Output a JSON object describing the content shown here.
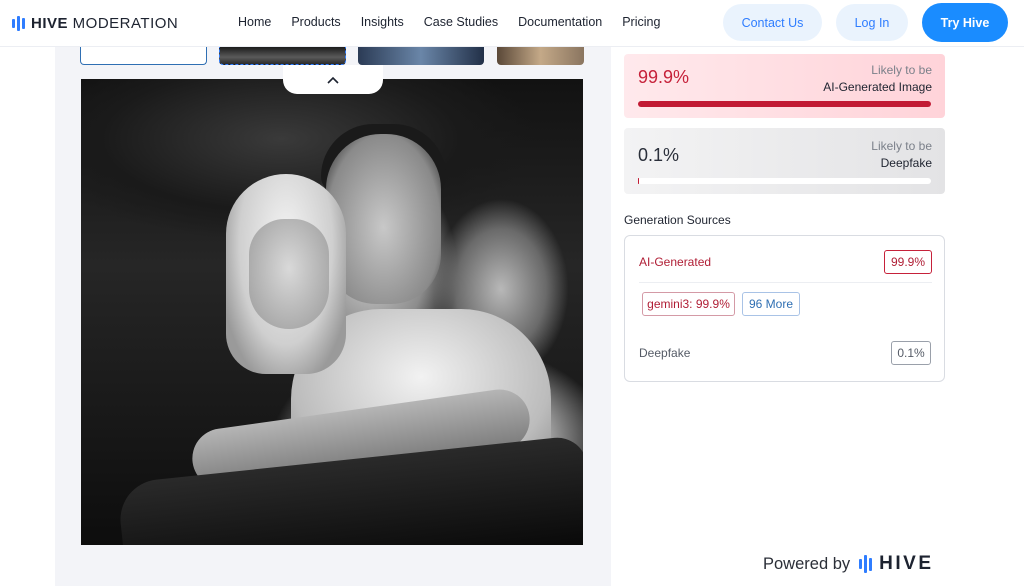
{
  "brand": {
    "name_bold": "HIVE",
    "name_rest": " MODERATION",
    "logo_icon": "hive-bars-icon",
    "accent": "#2f7dff"
  },
  "nav": {
    "items": [
      {
        "label": "Home"
      },
      {
        "label": "Products"
      },
      {
        "label": "Insights"
      },
      {
        "label": "Case Studies"
      },
      {
        "label": "Documentation"
      },
      {
        "label": "Pricing"
      }
    ],
    "contact_label": "Contact Us",
    "login_label": "Log In",
    "try_label": "Try Hive"
  },
  "preview": {
    "collapse_icon": "chevron-up-icon",
    "thumbnails": 4,
    "selected_thumbnail": 2
  },
  "results": {
    "ai": {
      "score": "99.9%",
      "likely_line1": "Likely to be",
      "likely_line2": "AI-Generated Image",
      "fraction": 0.999,
      "color": "#c21a34"
    },
    "deepfake": {
      "score": "0.1%",
      "likely_line1": "Likely to be",
      "likely_line2": "Deepfake",
      "fraction": 0.001
    }
  },
  "sources": {
    "title": "Generation Sources",
    "ai_label": "AI-Generated",
    "ai_value": "99.9%",
    "chips": [
      {
        "label": "gemini3: 99.9%"
      },
      {
        "label": "96 More"
      }
    ],
    "deepfake_label": "Deepfake",
    "deepfake_value": "0.1%"
  },
  "footer": {
    "powered_text": "Powered by",
    "powered_brand": "HIVE"
  }
}
